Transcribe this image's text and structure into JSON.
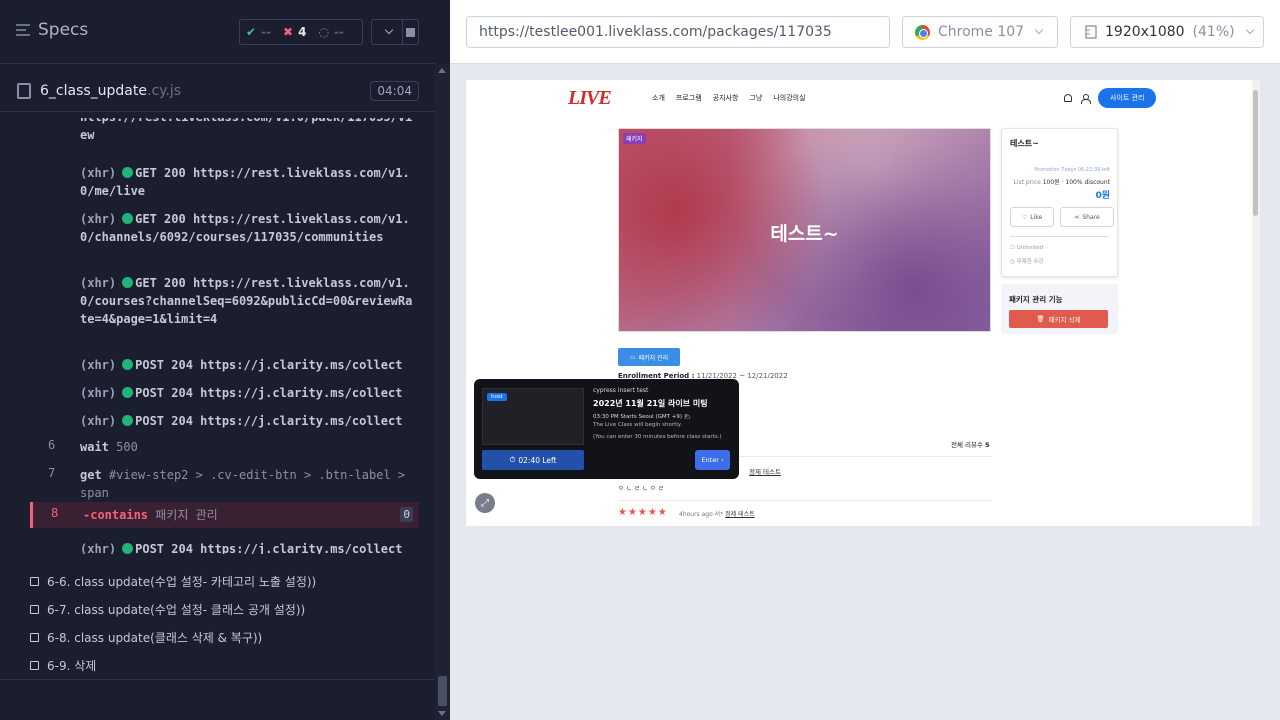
{
  "runner": {
    "specs_label": "Specs",
    "stats": {
      "passed": "--",
      "failed": "4",
      "pending": "--"
    },
    "file": {
      "name": "6_class_update",
      "ext": ".cy.js",
      "duration": "04:04"
    },
    "commands": [
      {
        "num": "",
        "kind": "text",
        "text": "https://rest.liveklass.com/v1.0/pack/117035/view"
      },
      {
        "num": "",
        "kind": "xhr",
        "method": "GET 200",
        "url": "https://rest.liveklass.com/v1.0/me/live"
      },
      {
        "num": "",
        "kind": "xhr",
        "method": "GET 200",
        "url": "https://rest.liveklass.com/v1.0/channels/6092/courses/117035/communities"
      },
      {
        "num": "",
        "kind": "xhr",
        "method": "GET 200",
        "url": "https://rest.liveklass.com/v1.0/courses?channelSeq=6092&publicCd=00&reviewRate=4&page=1&limit=4"
      },
      {
        "num": "",
        "kind": "xhr",
        "method": "POST 204",
        "url": "https://j.clarity.ms/collect"
      },
      {
        "num": "",
        "kind": "xhr",
        "method": "POST 204",
        "url": "https://j.clarity.ms/collect"
      },
      {
        "num": "",
        "kind": "xhr",
        "method": "POST 204",
        "url": "https://j.clarity.ms/collect"
      },
      {
        "num": "6",
        "kind": "cmd",
        "name": "wait",
        "arg": "500"
      },
      {
        "num": "7",
        "kind": "cmd",
        "name": "get",
        "arg": "#view-step2 > .cv-edit-btn > .btn-label > span"
      },
      {
        "num": "8",
        "kind": "failed",
        "name": "-contains",
        "arg": "패키지 관리",
        "badge": "0"
      },
      {
        "num": "",
        "kind": "xhr",
        "method": "POST 204",
        "url": "https://j.clarity.ms/collect"
      }
    ],
    "xhr_label": "(xhr)",
    "tests": [
      "6-6. class update(수업 설정- 카테고리 노출 설정))",
      "6-7. class update(수업 설정- 클래스 공개 설정))",
      "6-8. class update(클래스 삭제 & 복구))",
      "6-9. 삭제"
    ]
  },
  "browser": {
    "url": "https://testlee001.liveklass.com/packages/117035",
    "name": "Chrome 107",
    "viewport": "1920x1080",
    "scale": "(41%)"
  },
  "app": {
    "logo": "LIVE",
    "nav": [
      "소개",
      "프로그램",
      "공지사항",
      "그냥",
      "나의강의실"
    ],
    "admin_button": "사이트 관리",
    "hero_tag": "패키지",
    "hero_title": "테스트~",
    "card": {
      "title": "테스트~",
      "promo": "Promotion 7days 06:22:39 left",
      "list_price_label": "List price",
      "list_price": "100원",
      "discount": "100% discount",
      "final_price": "0원",
      "like": "Like",
      "share": "Share",
      "meta1": "Unlimited",
      "meta2": "무제한 수강"
    },
    "mgmt": {
      "title": "패키지 관리 기능",
      "delete": "패키지 삭제"
    },
    "pkg_button": "패키지 관리",
    "period_label": "Enrollment Period :",
    "period_value": "11/21/2022 ~ 12/21/2022",
    "review_count_label": "전체 리뷰수",
    "review_count": "5",
    "review1_meta": "정제 테스트",
    "review2_text": "ㅇㄴㄹㄴㅇㄹ",
    "review2_ago": "4hours ago",
    "review2_by": "서",
    "review2_name": "정제 테스트",
    "live": {
      "host": "host",
      "subtitle": "cypress insert test",
      "title": "2022년 11월 21일 라이브 미팅",
      "time": "03:30 PM Starts Seoul (GMT +9)",
      "info1": "The Live Class will begin shortly.",
      "info2": "(You can enter 30 minutes before class starts.)",
      "left": "02:40 Left",
      "enter": "Enter"
    }
  }
}
